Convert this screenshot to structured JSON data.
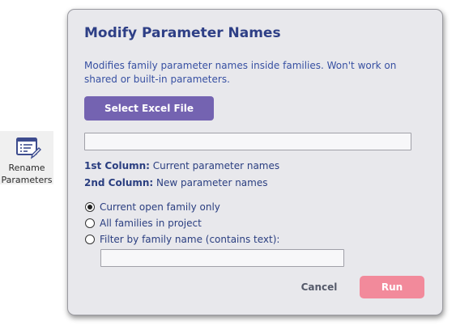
{
  "ribbon_tool": {
    "icon": "rename-parameters-icon",
    "label_line1": "Rename",
    "label_line2": "Parameters"
  },
  "dialog": {
    "title": "Modify Parameter Names",
    "description": "Modifies family parameter names inside families. Won't work on shared or built-in parameters.",
    "select_button": "Select Excel File",
    "file_path_value": "",
    "col1_label": "1st Column:",
    "col1_text": " Current parameter names",
    "col2_label": "2nd Column:",
    "col2_text": " New parameter names",
    "options": [
      {
        "label": "Current open family only",
        "selected": true
      },
      {
        "label": "All families in project",
        "selected": false
      },
      {
        "label": "Filter by family name (contains text):",
        "selected": false
      }
    ],
    "filter_value": "",
    "cancel_button": "Cancel",
    "run_button": "Run"
  },
  "colors": {
    "title": "#2e3f86",
    "select_button_bg": "#7463b1",
    "run_button_bg": "#f28a9b",
    "dialog_bg": "#e8e8ec"
  }
}
